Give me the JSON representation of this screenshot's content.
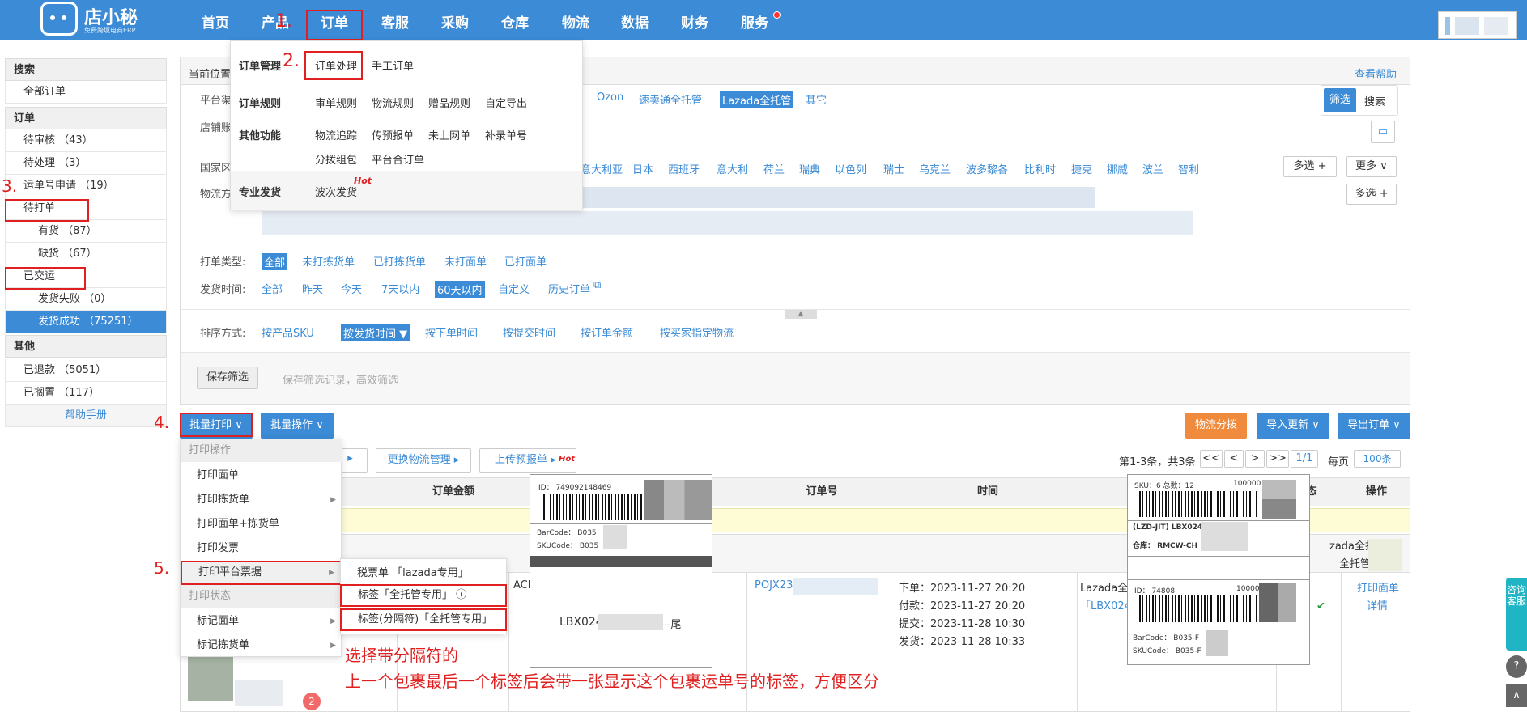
{
  "header": {
    "logo_text": "店小秘",
    "logo_sub": "免费跨境电商ERP",
    "nav": [
      "首页",
      "产品",
      "订单",
      "客服",
      "采购",
      "仓库",
      "物流",
      "数据",
      "财务",
      "服务"
    ]
  },
  "steps": {
    "s1": "1.",
    "s2": "2.",
    "s3": "3.",
    "s4": "4.",
    "s5": "5."
  },
  "order_menu": {
    "sec1": "订单管理",
    "order_process": "订单处理",
    "manual_order": "手工订单",
    "sec2": "订单规则",
    "rule1": "审单规则",
    "rule2": "物流规则",
    "rule3": "赠品规则",
    "rule4": "自定导出",
    "sec3": "其他功能",
    "f1": "物流追踪",
    "f2": "传预报单",
    "f3": "未上网单",
    "f4": "补录单号",
    "f5": "分拨组包",
    "f6": "平台合订单",
    "sec4": "专业发货",
    "wave": "波次发货",
    "hot": "Hot"
  },
  "sidebar": {
    "search": "搜索",
    "all_orders": "全部订单",
    "orders": "订单",
    "pending_review": "待审核 （43）",
    "pending_process": "待处理 （3）",
    "waybill_apply": "运单号申请 （19）",
    "to_print": "待打单",
    "in_stock": "有货 （87）",
    "out_stock": "缺货 （67）",
    "shipped": "已交运",
    "ship_fail": "发货失败 （0）",
    "ship_success": "发货成功 （75251）",
    "other": "其他",
    "refunded": "已退款 （5051）",
    "on_hold": "已搁置 （117）",
    "help": "帮助手册"
  },
  "filter": {
    "location": "当前位置",
    "help_link": "查看帮助",
    "platform_label": "平台渠",
    "platforms": [
      "Ozon",
      "速卖通全托管",
      "Lazada全托管",
      "其它"
    ],
    "shop_label": "店铺账",
    "btn_filter": "筛选",
    "btn_search": "搜索",
    "country_label": "国家区",
    "countries": [
      "意大利亚",
      "日本",
      "西班牙",
      "意大利",
      "荷兰",
      "瑞典",
      "以色列",
      "瑞士",
      "乌克兰",
      "波多黎各",
      "比利时",
      "捷克",
      "挪威",
      "波兰",
      "智利"
    ],
    "multi": "多选 +",
    "more": "更多 ∨",
    "logistics_label": "物流方",
    "print_type_label": "打单类型:",
    "print_types": [
      "全部",
      "未打拣货单",
      "已打拣货单",
      "未打面单",
      "已打面单"
    ],
    "ship_time_label": "发货时间:",
    "ship_times": [
      "全部",
      "昨天",
      "今天",
      "7天以内",
      "60天以内",
      "自定义",
      "历史订单"
    ],
    "sort_label": "排序方式:",
    "sorts": [
      "按产品SKU",
      "按发货时间 ▼",
      "按下单时间",
      "按提交时间",
      "按订单金额",
      "按买家指定物流"
    ],
    "save_filter": "保存筛选",
    "save_hint": "保存筛选记录，高效筛选"
  },
  "toolbar": {
    "batch_print": "批量打印 ∨",
    "batch_ops": "批量操作 ∨",
    "dispatch": "物流分拨",
    "import_update": "导入更新 ∨",
    "export_orders": "导出订单 ∨",
    "change_logistics": "更换物流管理 ▸",
    "upload_forecast": "上传预报单 ▸",
    "hot": "Hot",
    "paging": "第1-3条，共3条",
    "page_btns": [
      "<<",
      "<",
      ">",
      ">>"
    ],
    "page_num": "1/1",
    "per_page_label": "每页",
    "per_page": "100条"
  },
  "table": {
    "col_amount": "订单金额",
    "col_order_no": "订单号",
    "col_time": "时间",
    "col_status": "态",
    "col_ops": "操作",
    "order_no": "POJX23",
    "times": [
      "下单：2023-11-27 20:20",
      "付款：2023-11-27 20:20",
      "提交：2023-11-28 10:30",
      "发货：2023-11-28 10:33"
    ],
    "store": "Lazada全",
    "waybill": "「LBX024",
    "lazada_tg": "zada全托管：",
    "all_tg": "全托管",
    "op_print": "打印面单",
    "op_detail": "详情",
    "aci": "ACI",
    "badge": "2"
  },
  "print_menu": {
    "sec_ops": "打印操作",
    "print_label": "打印面单",
    "print_pick": "打印拣货单",
    "print_both": "打印面单+拣货单",
    "print_invoice": "打印发票",
    "print_platform": "打印平台票据",
    "sec_status": "打印状态",
    "mark_label": "标记面单",
    "mark_pick": "标记拣货单"
  },
  "sub_menu": {
    "tax": "税票单 「lazada专用」",
    "label": "标签「全托管专用」",
    "label_sep": "标签(分隔符)「全托管专用」"
  },
  "label_left": {
    "id": "ID：  749092148469",
    "barcode": "BarCode：  B035",
    "skucode": "SKUCode：  B035",
    "lbx": "LBX024",
    "tail": "--尾"
  },
  "label_right": {
    "sku": "SKU：6    总数：12",
    "num": "100000",
    "jit": "(LZD-JIT) LBX0245",
    "wh": "仓库：  RMCW-CH",
    "id": "ID：  74808",
    "num2": "100000",
    "barcode": "BarCode：  B035-F",
    "skucode": "SKUCode：  B035-F"
  },
  "annotation": {
    "line1": "选择带分隔符的",
    "line2": "上一个包裹最后一个标签后会带一张显示这个包裹运单号的标签，方便区分"
  },
  "right_widget": {
    "chat": "咨询客服",
    "help": "?",
    "top": "∧"
  }
}
